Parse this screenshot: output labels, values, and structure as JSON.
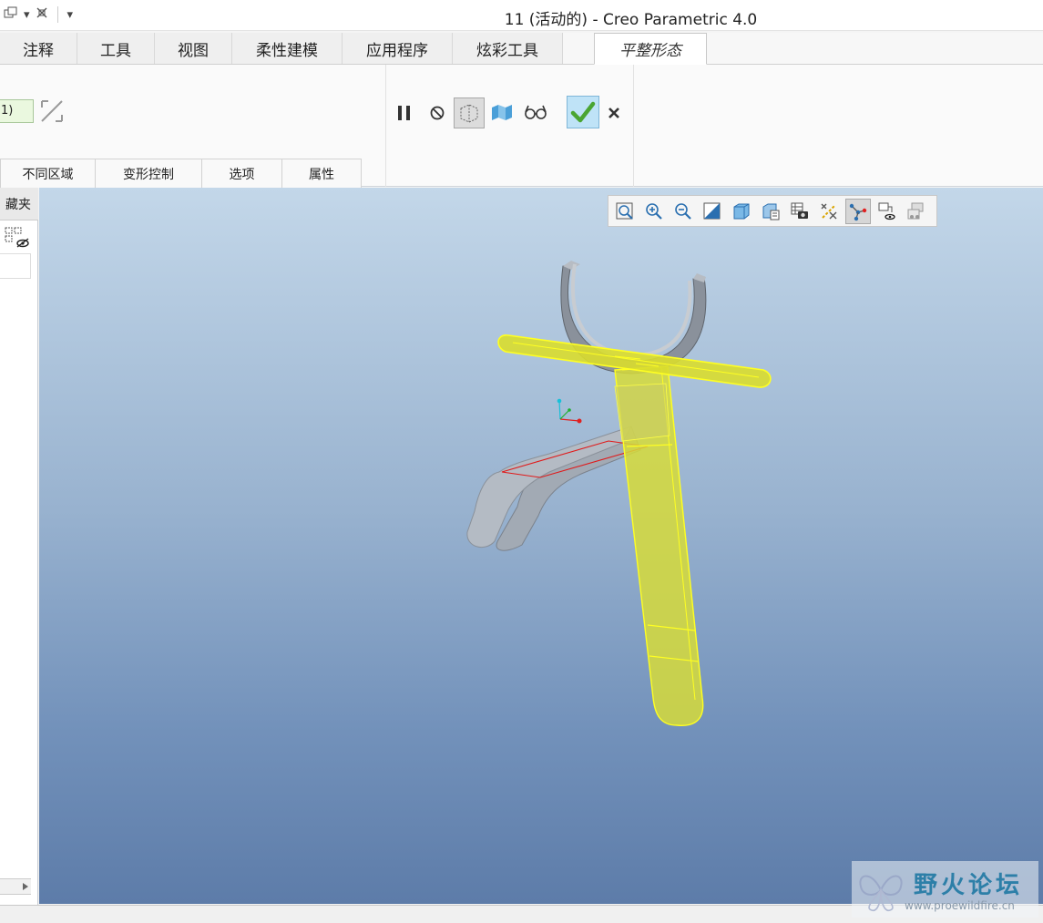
{
  "window": {
    "title": "11 (活动的) - Creo Parametric 4.0"
  },
  "tabs": [
    {
      "label": "注释",
      "width": 85
    },
    {
      "label": "工具",
      "width": 85
    },
    {
      "label": "视图",
      "width": 85
    },
    {
      "label": "柔性建模",
      "width": 121
    },
    {
      "label": "应用程序",
      "width": 121
    },
    {
      "label": "炫彩工具",
      "width": 121
    },
    {
      "label": "平整形态",
      "width": 124
    }
  ],
  "ribbon": {
    "value_field": "1)",
    "subtabs": [
      {
        "label": "不同区域",
        "width": 105
      },
      {
        "label": "变形控制",
        "width": 118
      },
      {
        "label": "选项",
        "width": 89
      },
      {
        "label": "属性",
        "width": 88
      }
    ]
  },
  "left_panel": {
    "tab_label": "藏夹"
  },
  "watermark": {
    "text": "野火论坛",
    "url": "www.proewildfire.cn"
  },
  "colors": {
    "highlight": "#ffff33",
    "viewport_top": "#c3d7e9",
    "viewport_bottom": "#5d7ca9",
    "confirm": "#4aa532"
  }
}
